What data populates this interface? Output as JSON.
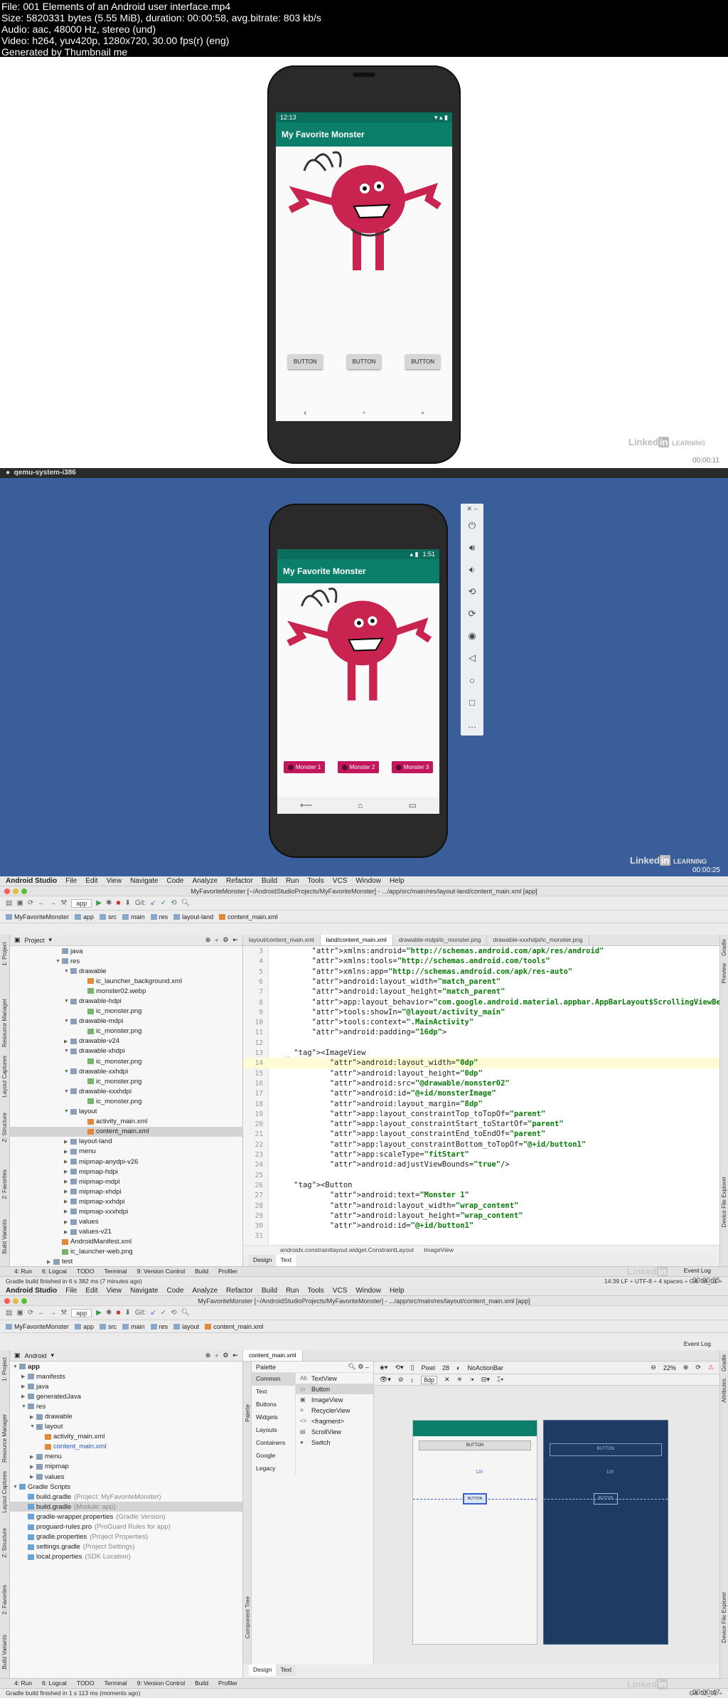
{
  "header": {
    "line1": "File: 001 Elements of an Android user interface.mp4",
    "line2": "Size: 5820331 bytes (5.55 MiB), duration: 00:00:58, avg.bitrate: 803 kb/s",
    "line3": "Audio: aac, 48000 Hz, stereo (und)",
    "line4": "Video: h264, yuv420p, 1280x720, 30.00 fps(r) (eng)",
    "line5": "Generated by Thumbnail me"
  },
  "frame1": {
    "time": "12:13",
    "app_title": "My Favorite Monster",
    "buttons": [
      "BUTTON",
      "BUTTON",
      "BUTTON"
    ],
    "brand": "Linked",
    "brand_in": "in",
    "brand_learning": "LEARNING",
    "timestamp": "00:00:11"
  },
  "macbar": {
    "app": "qemu-system-i386"
  },
  "frame2": {
    "time": "1:51",
    "app_title": "My Favorite Monster",
    "buttons": [
      "Monster 1",
      "Monster 2",
      "Monster 3"
    ],
    "brand": "Linked",
    "brand_in": "in",
    "brand_learning": "LEARNING",
    "timestamp": "00:00:25"
  },
  "ide1": {
    "menu": [
      "Android Studio",
      "File",
      "Edit",
      "View",
      "Navigate",
      "Code",
      "Analyze",
      "Refactor",
      "Build",
      "Run",
      "Tools",
      "VCS",
      "Window",
      "Help"
    ],
    "title": "MyFavoriteMonster [~/AndroidStudioProjects/MyFavoriteMonster] - .../app/src/main/res/layout-land/content_main.xml [app]",
    "run_config": "app",
    "git": "Git:",
    "breadcrumbs": [
      "MyFavoriteMonster",
      "app",
      "src",
      "main",
      "res",
      "layout-land",
      "content_main.xml"
    ],
    "tree_header": "Project",
    "tree": [
      {
        "label": "java",
        "indent": 5,
        "kind": "folder",
        "arrow": ""
      },
      {
        "label": "res",
        "indent": 5,
        "kind": "folder",
        "arrow": "▼"
      },
      {
        "label": "drawable",
        "indent": 6,
        "kind": "folder",
        "arrow": "▼"
      },
      {
        "label": "ic_launcher_background.xml",
        "indent": 8,
        "kind": "file-x",
        "arrow": ""
      },
      {
        "label": "monster02.webp",
        "indent": 8,
        "kind": "file-p",
        "arrow": ""
      },
      {
        "label": "drawable-hdpi",
        "indent": 6,
        "kind": "folder",
        "arrow": "▼"
      },
      {
        "label": "ic_monster.png",
        "indent": 8,
        "kind": "file-p",
        "arrow": ""
      },
      {
        "label": "drawable-mdpi",
        "indent": 6,
        "kind": "folder",
        "arrow": "▼"
      },
      {
        "label": "ic_monster.png",
        "indent": 8,
        "kind": "file-p",
        "arrow": ""
      },
      {
        "label": "drawable-v24",
        "indent": 6,
        "kind": "folder",
        "arrow": "▶"
      },
      {
        "label": "drawable-xhdpi",
        "indent": 6,
        "kind": "folder",
        "arrow": "▼"
      },
      {
        "label": "ic_monster.png",
        "indent": 8,
        "kind": "file-p",
        "arrow": ""
      },
      {
        "label": "drawable-xxhdpi",
        "indent": 6,
        "kind": "folder",
        "arrow": "▼"
      },
      {
        "label": "ic_monster.png",
        "indent": 8,
        "kind": "file-p",
        "arrow": ""
      },
      {
        "label": "drawable-xxxhdpi",
        "indent": 6,
        "kind": "folder",
        "arrow": "▼"
      },
      {
        "label": "ic_monster.png",
        "indent": 8,
        "kind": "file-p",
        "arrow": ""
      },
      {
        "label": "layout",
        "indent": 6,
        "kind": "folder",
        "arrow": "▼"
      },
      {
        "label": "activity_main.xml",
        "indent": 8,
        "kind": "file-x",
        "arrow": ""
      },
      {
        "label": "content_main.xml",
        "indent": 8,
        "kind": "file-x",
        "arrow": "",
        "sel": true
      },
      {
        "label": "layout-land",
        "indent": 6,
        "kind": "folder",
        "arrow": "▶"
      },
      {
        "label": "menu",
        "indent": 6,
        "kind": "folder",
        "arrow": "▶"
      },
      {
        "label": "mipmap-anydpi-v26",
        "indent": 6,
        "kind": "folder",
        "arrow": "▶"
      },
      {
        "label": "mipmap-hdpi",
        "indent": 6,
        "kind": "folder",
        "arrow": "▶"
      },
      {
        "label": "mipmap-mdpi",
        "indent": 6,
        "kind": "folder",
        "arrow": "▶"
      },
      {
        "label": "mipmap-xhdpi",
        "indent": 6,
        "kind": "folder",
        "arrow": "▶"
      },
      {
        "label": "mipmap-xxhdpi",
        "indent": 6,
        "kind": "folder",
        "arrow": "▶"
      },
      {
        "label": "mipmap-xxxhdpi",
        "indent": 6,
        "kind": "folder",
        "arrow": "▶"
      },
      {
        "label": "values",
        "indent": 6,
        "kind": "folder",
        "arrow": "▶"
      },
      {
        "label": "values-v21",
        "indent": 6,
        "kind": "folder",
        "arrow": "▶"
      },
      {
        "label": "AndroidManifest.xml",
        "indent": 5,
        "kind": "file-x",
        "arrow": ""
      },
      {
        "label": "ic_launcher-web.png",
        "indent": 5,
        "kind": "file-p",
        "arrow": ""
      },
      {
        "label": "test",
        "indent": 4,
        "kind": "folder",
        "arrow": "▶"
      }
    ],
    "tabs": [
      "layout/content_main.xml",
      "land/content_main.xml",
      "drawable-mdpi/ic_monster.png",
      "drawable-xxxhdpi/ic_monster.png"
    ],
    "active_tab": 1,
    "code": [
      {
        "n": "3",
        "t": "        xmlns:android=\"http://schemas.android.com/apk/res/android\""
      },
      {
        "n": "4",
        "t": "        xmlns:tools=\"http://schemas.android.com/tools\""
      },
      {
        "n": "5",
        "t": "        xmlns:app=\"http://schemas.android.com/apk/res-auto\""
      },
      {
        "n": "6",
        "t": "        android:layout_width=\"match_parent\""
      },
      {
        "n": "7",
        "t": "        android:layout_height=\"match_parent\""
      },
      {
        "n": "8",
        "t": "        app:layout_behavior=\"com.google.android.material.appbar.AppBarLayout$ScrollingViewBehavior\""
      },
      {
        "n": "9",
        "t": "        tools:showIn=\"@layout/activity_main\""
      },
      {
        "n": "10",
        "t": "        tools:context=\".MainActivity\""
      },
      {
        "n": "11",
        "t": "        android:padding=\"16dp\">"
      },
      {
        "n": "12",
        "t": ""
      },
      {
        "n": "13",
        "t": "    <ImageView"
      },
      {
        "n": "14",
        "t": "            android:layout_width=\"0dp\"",
        "hl": true
      },
      {
        "n": "15",
        "t": "            android:layout_height=\"0dp\""
      },
      {
        "n": "16",
        "t": "            android:src=\"@drawable/monster02\""
      },
      {
        "n": "17",
        "t": "            android:id=\"@+id/monsterImage\""
      },
      {
        "n": "18",
        "t": "            android:layout_margin=\"8dp\""
      },
      {
        "n": "19",
        "t": "            app:layout_constraintTop_toTopOf=\"parent\""
      },
      {
        "n": "20",
        "t": "            app:layout_constraintStart_toStartOf=\"parent\""
      },
      {
        "n": "21",
        "t": "            app:layout_constraintEnd_toEndOf=\"parent\""
      },
      {
        "n": "22",
        "t": "            app:layout_constraintBottom_toTopOf=\"@+id/button1\""
      },
      {
        "n": "23",
        "t": "            app:scaleType=\"fitStart\""
      },
      {
        "n": "24",
        "t": "            android:adjustViewBounds=\"true\"/>"
      },
      {
        "n": "25",
        "t": ""
      },
      {
        "n": "26",
        "t": "    <Button"
      },
      {
        "n": "27",
        "t": "            android:text=\"Monster 1\""
      },
      {
        "n": "28",
        "t": "            android:layout_width=\"wrap_content\""
      },
      {
        "n": "29",
        "t": "            android:layout_height=\"wrap_content\""
      },
      {
        "n": "30",
        "t": "            android:id=\"@+id/button1\""
      },
      {
        "n": "31",
        "t": ""
      }
    ],
    "editor_breadcrumb": [
      "androidx.constraintlayout.widget.ConstraintLayout",
      "ImageView"
    ],
    "design_tabs": [
      "Design",
      "Text"
    ],
    "bottom_tabs": [
      "4: Run",
      "6: Logcat",
      "TODO",
      "Terminal",
      "9: Version Control",
      "Build",
      "Profiler"
    ],
    "event_log": "Event Log",
    "status_left": "Gradle build finished in 6 s 382 ms (7 minutes ago)",
    "status_right": "14:39  LF ÷  UTF-8 ÷  4 spaces ÷  Git: 06_01 ÷",
    "left_tabs": [
      "1: Project",
      "Resource Manager",
      "Layout Captures",
      "Z: Structure",
      "2: Favorites",
      "Build Variants"
    ],
    "right_tabs": [
      "Gradle",
      "Preview",
      "Device File Explorer"
    ],
    "brand": "Linked",
    "brand_in": "in",
    "timestamp": "00:00:35"
  },
  "ide2": {
    "menu": [
      "Android Studio",
      "File",
      "Edit",
      "View",
      "Navigate",
      "Code",
      "Analyze",
      "Refactor",
      "Build",
      "Run",
      "Tools",
      "VCS",
      "Window",
      "Help"
    ],
    "title": "MyFavoriteMonster [~/AndroidStudioProjects/MyFavoriteMonster] - .../app/src/main/res/layout/content_main.xml [app]",
    "run_config": "app",
    "git": "Git:",
    "breadcrumbs": [
      "MyFavoriteMonster",
      "app",
      "src",
      "main",
      "res",
      "layout",
      "content_main.xml"
    ],
    "tree_header": "Android",
    "tree": [
      {
        "label": "app",
        "indent": 0,
        "kind": "folder",
        "arrow": "▼",
        "bold": true
      },
      {
        "label": "manifests",
        "indent": 1,
        "kind": "folder",
        "arrow": "▶"
      },
      {
        "label": "java",
        "indent": 1,
        "kind": "folder",
        "arrow": "▶"
      },
      {
        "label": "generatedJava",
        "indent": 1,
        "kind": "folder",
        "arrow": "▶"
      },
      {
        "label": "res",
        "indent": 1,
        "kind": "folder",
        "arrow": "▼"
      },
      {
        "label": "drawable",
        "indent": 2,
        "kind": "folder",
        "arrow": "▶"
      },
      {
        "label": "layout",
        "indent": 2,
        "kind": "folder",
        "arrow": "▼"
      },
      {
        "label": "activity_main.xml",
        "indent": 3,
        "kind": "file-x",
        "arrow": ""
      },
      {
        "label": "content_main.xml",
        "indent": 3,
        "kind": "file-x",
        "arrow": "",
        "blue": true
      },
      {
        "label": "menu",
        "indent": 2,
        "kind": "folder",
        "arrow": "▶"
      },
      {
        "label": "mipmap",
        "indent": 2,
        "kind": "folder",
        "arrow": "▶"
      },
      {
        "label": "values",
        "indent": 2,
        "kind": "folder",
        "arrow": "▶"
      },
      {
        "label": "Gradle Scripts",
        "indent": 0,
        "kind": "file-g",
        "arrow": "▼"
      },
      {
        "label": "build.gradle",
        "note": "(Project: MyFavoriteMonster)",
        "indent": 1,
        "kind": "file-g",
        "arrow": ""
      },
      {
        "label": "build.gradle",
        "note": "(Module: app)",
        "indent": 1,
        "kind": "file-g",
        "arrow": "",
        "sel": true
      },
      {
        "label": "gradle-wrapper.properties",
        "note": "(Gradle Version)",
        "indent": 1,
        "kind": "file-g",
        "arrow": ""
      },
      {
        "label": "proguard-rules.pro",
        "note": "(ProGuard Rules for app)",
        "indent": 1,
        "kind": "file-g",
        "arrow": ""
      },
      {
        "label": "gradle.properties",
        "note": "(Project Properties)",
        "indent": 1,
        "kind": "file-g",
        "arrow": ""
      },
      {
        "label": "settings.gradle",
        "note": "(Project Settings)",
        "indent": 1,
        "kind": "file-g",
        "arrow": ""
      },
      {
        "label": "local.properties",
        "note": "(SDK Location)",
        "indent": 1,
        "kind": "file-g",
        "arrow": ""
      }
    ],
    "tabs": [
      "content_main.xml"
    ],
    "palette_title": "Palette",
    "palette_cats": [
      "Common",
      "Text",
      "Buttons",
      "Widgets",
      "Layouts",
      "Containers",
      "Google",
      "Legacy"
    ],
    "palette_items": [
      {
        "icon": "Ab",
        "label": "TextView"
      },
      {
        "icon": "▭",
        "label": "Button",
        "sel": true
      },
      {
        "icon": "▣",
        "label": "ImageView"
      },
      {
        "icon": "≡",
        "label": "RecyclerView"
      },
      {
        "icon": "<>",
        "label": "<fragment>"
      },
      {
        "icon": "▤",
        "label": "ScrollView"
      },
      {
        "icon": "●",
        "label": "Switch"
      }
    ],
    "device": "Pixel",
    "api": "28",
    "theme": "NoActionBar",
    "zoom": "22%",
    "margin": "8dp",
    "bp_button": "BUTTON",
    "bp_button2": "BUTTON",
    "bp_value": "120",
    "component_tree": "Component Tree",
    "design_tabs": [
      "Design",
      "Text"
    ],
    "bottom_tabs": [
      "4: Run",
      "6: Logcat",
      "TODO",
      "Terminal",
      "9: Version Control",
      "Build",
      "Profiler"
    ],
    "event_log": "Event Log",
    "status_left": "Gradle build finished in 1 s 113 ms (moments ago)",
    "status_right": "Git: 02_02 ÷",
    "left_tabs": [
      "1: Project",
      "Resource Manager",
      "Layout Captures",
      "Z: Structure",
      "2: Favorites",
      "Build Variants"
    ],
    "right_tabs": [
      "Gradle",
      "Attributes",
      "Device File Explorer"
    ],
    "brand": "Linked",
    "brand_in": "in",
    "timestamp": "00:00:47"
  }
}
